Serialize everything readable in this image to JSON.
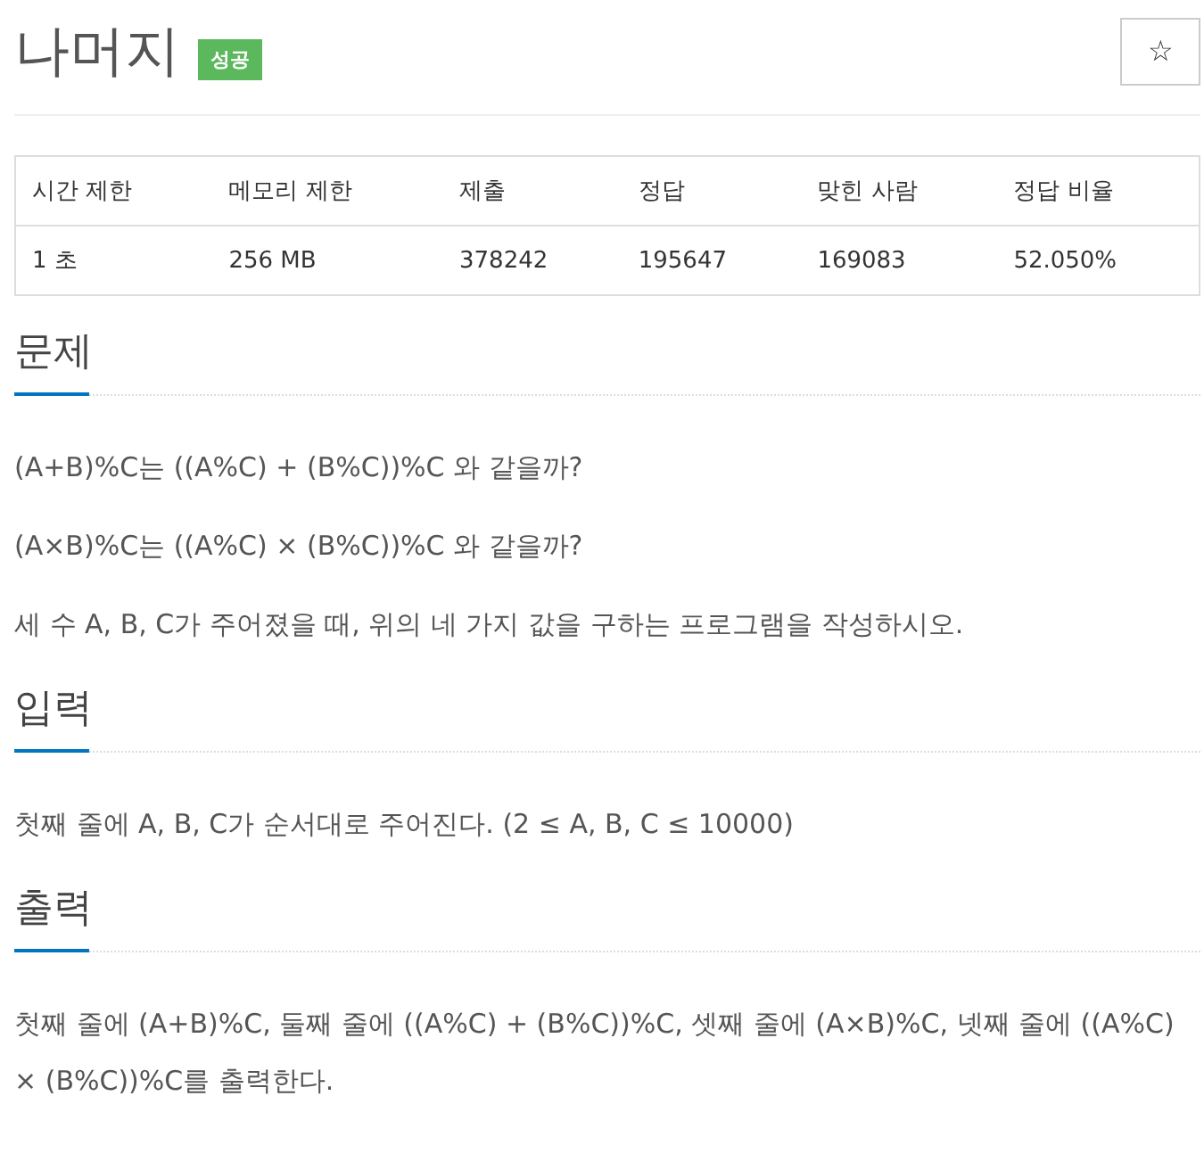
{
  "title": "나머지",
  "badge": {
    "label": "성공",
    "color": "#5cb85c"
  },
  "star_button": "☆",
  "table": {
    "columns": [
      "시간 제한",
      "메모리 제한",
      "제출",
      "정답",
      "맞힌 사람",
      "정답 비율"
    ],
    "rows": [
      [
        "1 초",
        "256 MB",
        "378242",
        "195647",
        "169083",
        "52.050%"
      ]
    ]
  },
  "sections": [
    {
      "heading": "문제",
      "paragraphs": [
        "(A+B)%C는 ((A%C) + (B%C))%C 와 같을까?",
        "(A×B)%C는 ((A%C) × (B%C))%C 와 같을까?",
        "세 수 A, B, C가 주어졌을 때, 위의 네 가지 값을 구하는 프로그램을 작성하시오."
      ]
    },
    {
      "heading": "입력",
      "paragraphs": [
        "첫째 줄에 A, B, C가 순서대로 주어진다. (2 ≤ A, B, C ≤ 10000)"
      ]
    },
    {
      "heading": "출력",
      "paragraphs": [
        "첫째 줄에 (A+B)%C, 둘째 줄에 ((A%C) + (B%C))%C, 셋째 줄에 (A×B)%C, 넷째 줄에 ((A%C) × (B%C))%C를 출력한다."
      ]
    }
  ]
}
